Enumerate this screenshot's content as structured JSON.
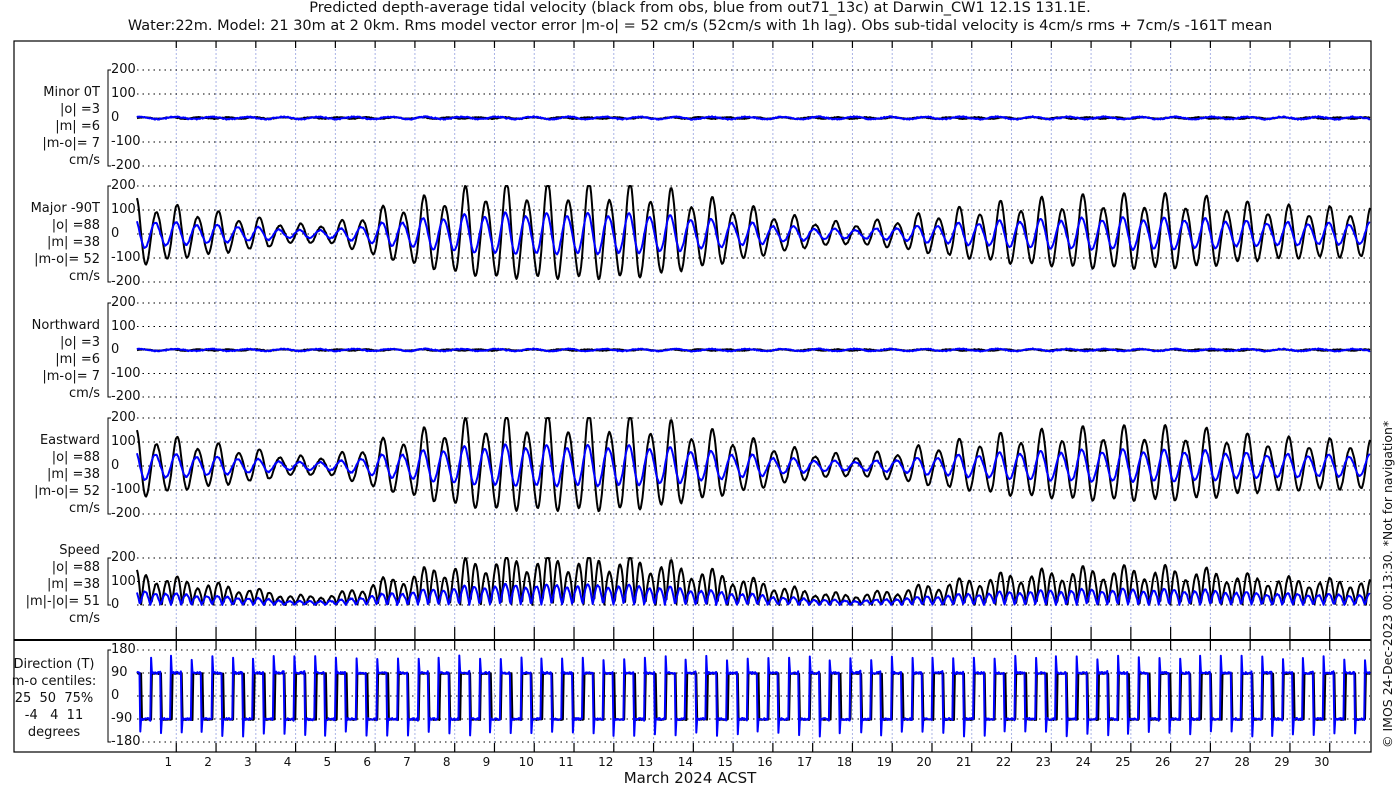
{
  "title": {
    "line1": "Predicted depth-average tidal velocity (black from obs, blue from out71_13c) at Darwin_CW1 12.1S 131.1E.",
    "line2": "Water:22m. Model: 21 30m at 2 0km. Rms model vector error |m-o| = 52 cm/s (52cm/s with 1h lag). Obs sub-tidal velocity is 4cm/s rms + 7cm/s -161T mean"
  },
  "copyright": "© IMOS 24-Dec-2023 00:13:30. *Not for navigation*",
  "colors": {
    "obs": "#000000",
    "model": "#0000ff",
    "grid": "#000000",
    "day_lines": "#aab4e6"
  },
  "chart_data": {
    "type": "line",
    "xlabel": "March 2024 ACST",
    "x_ticks": [
      "1",
      "2",
      "3",
      "4",
      "5",
      "6",
      "7",
      "8",
      "9",
      "10",
      "11",
      "12",
      "13",
      "14",
      "15",
      "16",
      "17",
      "18",
      "19",
      "20",
      "21",
      "22",
      "23",
      "24",
      "25",
      "26",
      "27",
      "28",
      "29",
      "30"
    ],
    "xlim_days": [
      0,
      31
    ],
    "legend": "in title: black = obs, blue = model",
    "tidal_period_hours": 12.42,
    "model_amplitude_ratio": 0.45,
    "daily_major_amplitude_obs_cms": [
      130,
      100,
      80,
      60,
      35,
      40,
      90,
      125,
      160,
      180,
      180,
      180,
      180,
      170,
      140,
      110,
      80,
      50,
      40,
      55,
      80,
      100,
      120,
      130,
      140,
      140,
      140,
      130,
      110,
      100,
      95
    ],
    "panels": [
      {
        "id": "minor",
        "label": [
          "Minor 0T",
          "|o| =3",
          "|m| =6",
          "|m-o|= 7",
          "cm/s"
        ],
        "ylim": [
          -200,
          200
        ],
        "yticks": [
          "200",
          "100",
          "0",
          "-100",
          "-200"
        ],
        "obs_rms": 3,
        "model_rms": 6,
        "error_rms": 7
      },
      {
        "id": "major",
        "label": [
          "Major -90T",
          "|o| =88",
          "|m| =38",
          "|m-o|= 52",
          "cm/s"
        ],
        "ylim": [
          -200,
          200
        ],
        "yticks": [
          "200",
          "100",
          "0",
          "-100",
          "-200"
        ],
        "obs_rms": 88,
        "model_rms": 38,
        "error_rms": 52
      },
      {
        "id": "north",
        "label": [
          "Northward",
          "|o| =3",
          "|m| =6",
          "|m-o|= 7",
          "cm/s"
        ],
        "ylim": [
          -200,
          200
        ],
        "yticks": [
          "200",
          "100",
          "0",
          "-100",
          "-200"
        ],
        "obs_rms": 3,
        "model_rms": 6,
        "error_rms": 7
      },
      {
        "id": "east",
        "label": [
          "Eastward",
          "|o| =88",
          "|m| =38",
          "|m-o|= 52",
          "cm/s"
        ],
        "ylim": [
          -200,
          200
        ],
        "yticks": [
          "200",
          "100",
          "0",
          "-100",
          "-200"
        ],
        "obs_rms": 88,
        "model_rms": 38,
        "error_rms": 52
      },
      {
        "id": "speed",
        "label": [
          "Speed",
          "|o| =88",
          "|m| =38",
          "|m|-|o|= 51",
          "cm/s"
        ],
        "ylim": [
          0,
          200
        ],
        "yticks": [
          "200",
          "100",
          "0"
        ],
        "obs_rms": 88,
        "model_rms": 38,
        "error_rms": 51
      },
      {
        "id": "direction",
        "label": [
          "Direction (T)",
          "m-o centiles:",
          "25  50  75%",
          "-4   4  11",
          "degrees"
        ],
        "ylim": [
          -180,
          180
        ],
        "yticks": [
          "180",
          "90",
          "0",
          "-90",
          "-180"
        ],
        "centiles": {
          "25": -4,
          "50": 4,
          "75": 11
        }
      }
    ]
  }
}
